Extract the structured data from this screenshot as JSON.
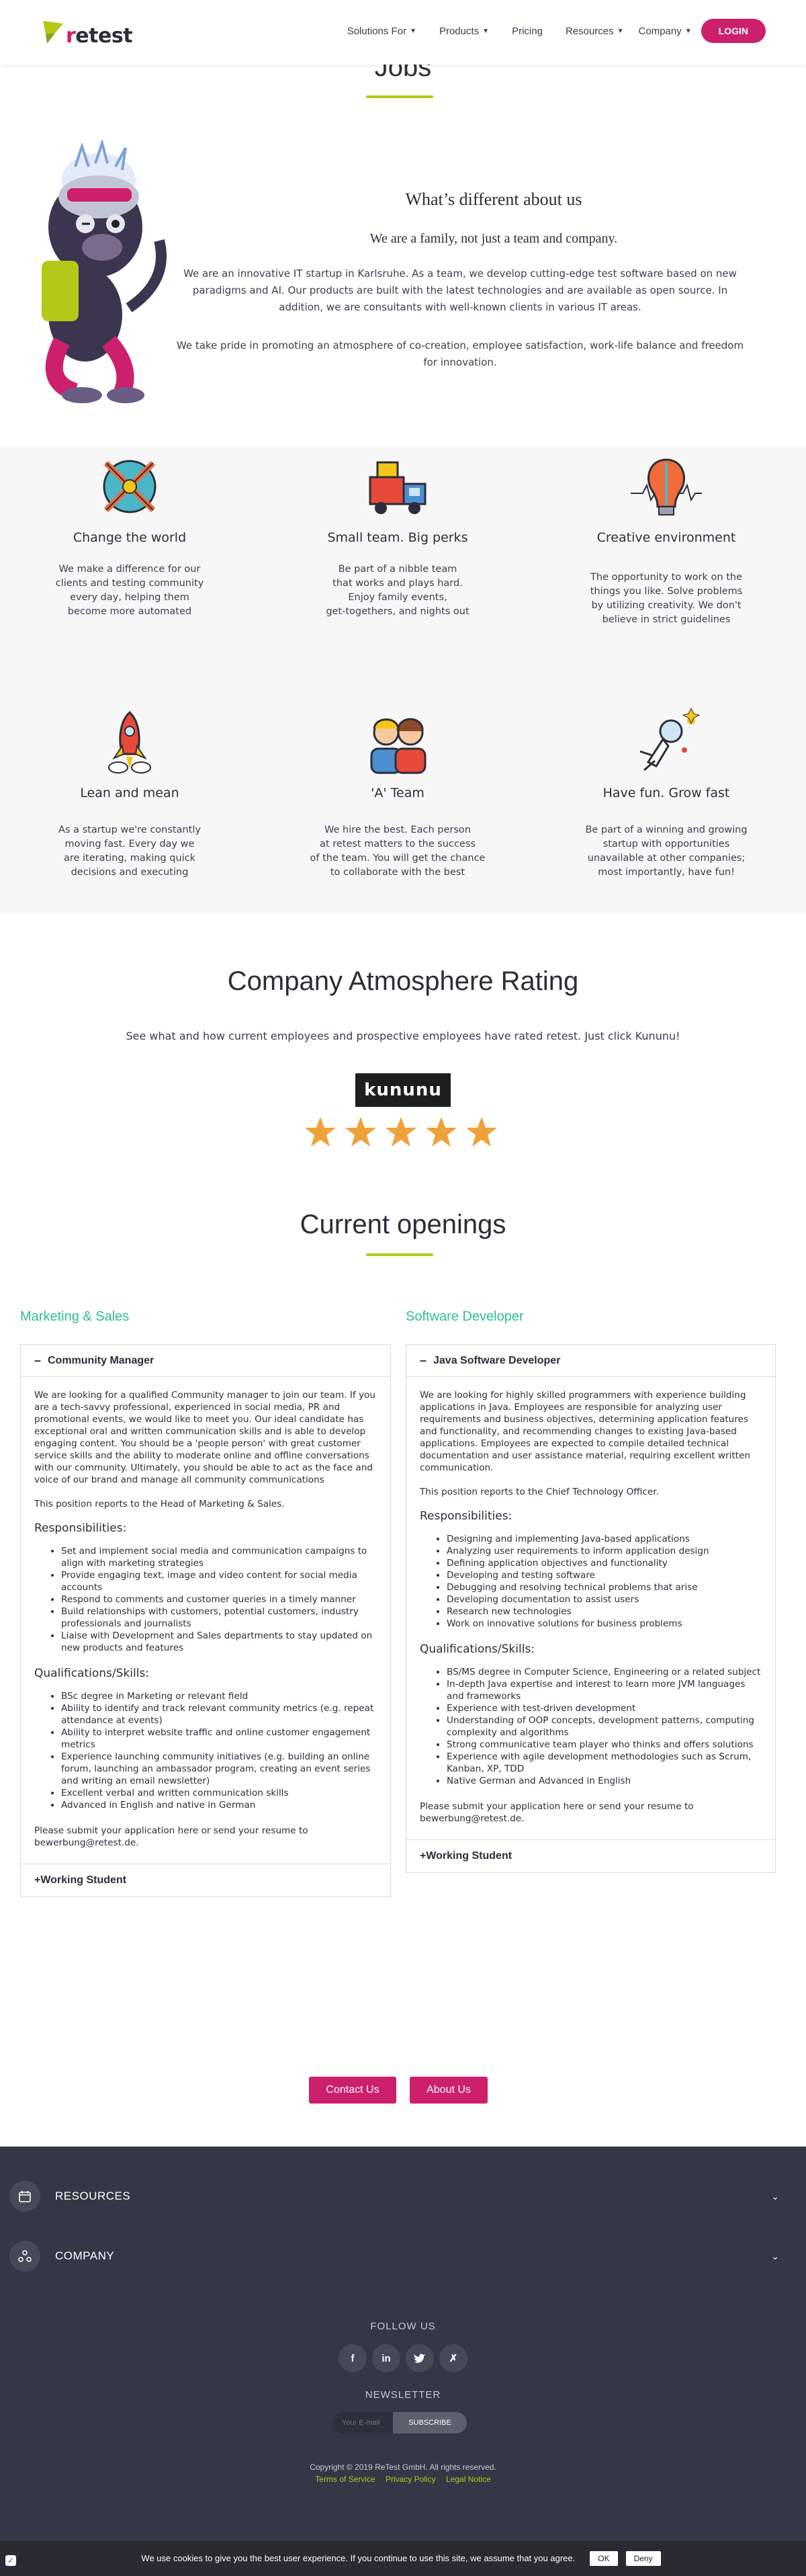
{
  "header": {
    "logo_text": "retest",
    "nav": [
      "Solutions For",
      "Products",
      "Pricing",
      "Resources",
      "Company"
    ],
    "login": "LOGIN"
  },
  "page_title": "Jobs",
  "about": {
    "heading": "What’s different about us",
    "subheading": "We are a family, not just a team and company.",
    "p1": "We are an innovative IT startup in Karlsruhe. As a team, we develop cutting-edge test software based on new paradigms and AI. Our products are built with the latest technologies and are available as open source. In addition, we are consultants with well-known clients in various IT areas.",
    "p2": "We take pride in promoting an atmosphere of co-creation, employee satisfaction, work-life balance and freedom for innovation."
  },
  "perks": [
    {
      "icon": "globe-tools-icon",
      "title": "Change the world",
      "text": "We make a difference for our\nclients and testing community\nevery day, helping them\nbecome more automated"
    },
    {
      "icon": "delivery-truck-icon",
      "title": "Small team. Big perks",
      "text": "Be part of a nibble team\nthat works and plays hard.\nEnjoy family events,\nget-togethers, and nights out"
    },
    {
      "icon": "lightbulb-brain-icon",
      "title": "Creative environment",
      "text": "The opportunity to work on the\nthings you like. Solve problems\nby utilizing creativity. We don't\nbelieve in strict guidelines"
    },
    {
      "icon": "rocket-icon",
      "title": "Lean and mean",
      "text": "As a startup we're constantly\nmoving fast. Every day we\nare iterating, making quick\ndecisions and executing"
    },
    {
      "icon": "team-people-icon",
      "title": "'A' Team",
      "text": "We hire the best. Each person\nat retest matters to the success\nof the team. You will get the chance\nto collaborate with the best"
    },
    {
      "icon": "astronaut-icon",
      "title": "Have fun. Grow fast",
      "text": "Be part of a winning and growing\nstartup with opportunities\nunavailable at other companies;\nmost importantly, have fun!"
    }
  ],
  "rating": {
    "title": "Company Atmosphere Rating",
    "subtitle": "See what and how current employees and prospective employees have rated retest. Just click Kununu!",
    "kununu": "kununu",
    "stars": 5
  },
  "openings_title": "Current openings",
  "marketing": {
    "title": "Marketing & Sales",
    "job": "Community Manager",
    "p1": "We are looking for a qualified Community manager to join our team. If you are a tech-savvy professional, experienced in social media, PR and promotional events, we would like to meet you. Our ideal candidate has exceptional oral and written communication skills and is able to develop engaging content. You should be a 'people person' with great customer service skills and the ability to moderate online and offline conversations with our community. Ultimately, you should be able to act as the face and voice of our brand and manage all community communications",
    "p2": "This position reports to the Head of Marketing & Sales.",
    "resp_title": "Responsibilities:",
    "resp": [
      "Set and implement social media and communication campaigns to align with marketing strategies",
      "Provide engaging text, image and video content for social media accounts",
      "Respond to comments and customer queries in a timely manner",
      "Build relationships with customers, potential customers, industry professionals and journalists",
      "Liaise with Development and Sales departments to stay updated on new products and features"
    ],
    "qual_title": "Qualifications/Skills:",
    "qual": [
      "BSc degree in Marketing or relevant field",
      "Ability to identify and track relevant community metrics (e.g. repeat attendance at events)",
      "Ability to interpret website traffic and online customer engagement metrics",
      "Experience launching community initiatives (e.g. building an online forum, launching an ambassador program, creating an event series and writing an email newsletter)",
      "Excellent verbal and written communication skills",
      "Advanced in English and native in German"
    ],
    "apply": "Please submit your application here or send your resume to bewerbung@retest.de.",
    "other": "Working Student"
  },
  "software": {
    "title": "Software Developer",
    "job": "Java Software Developer",
    "p1": "We are looking for highly skilled programmers with experience building applications in Java. Employees are responsible for analyzing user requirements and business objectives, determining application features and functionality, and recommending changes to existing Java-based applications. Employees are expected to compile detailed technical documentation and user assistance material, requiring excellent written communication.",
    "p2": "This position reports to the Chief Technology Officer.",
    "resp_title": "Responsibilities:",
    "resp": [
      "Designing and implementing Java-based applications",
      "Analyzing user requirements to inform application design",
      "Defining application objectives and functionality",
      "Developing and testing software",
      "Debugging and resolving technical problems that arise",
      "Developing documentation to assist users",
      "Research new technologies",
      "Work on innovative solutions for business problems"
    ],
    "qual_title": "Qualifications/Skills:",
    "qual": [
      "BS/MS degree in Computer Science, Engineering or a related subject",
      "In-depth Java expertise and interest to learn more JVM languages and frameworks",
      "Experience with test-driven development",
      "Understanding of OOP concepts, development patterns, computing complexity and algorithms",
      "Strong communicative team player who thinks and offers solutions",
      "Experience with agile development methodologies such as Scrum, Kanban, XP, TDD",
      "Native German and Advanced in English"
    ],
    "apply": "Please submit your application here or send your resume to bewerbung@retest.de.",
    "other": "Working Student"
  },
  "cta": {
    "contact": "Contact Us",
    "about": "About Us"
  },
  "footer": {
    "resources": "RESOURCES",
    "company": "COMPANY",
    "follow": "FOLLOW US",
    "socials": [
      "f",
      "in",
      "tw",
      "x"
    ],
    "newsletter": "NEWSLETTER",
    "email_placeholder": "Your E-mail",
    "subscribe": "SUBSCRIBE",
    "copyright": "Copyright © 2019 ReTest GmbH. All rights reserved.",
    "terms": "Terms of Service",
    "privacy": "Privacy Policy",
    "legal": "Legal Notice"
  },
  "cookie": {
    "text": "We use cookies to give you the best user experience. If you continue to use this site, we assume that you agree.",
    "ok": "OK",
    "deny": "Deny"
  },
  "colors": {
    "brand": "#cc1f6c",
    "accent_green": "#b5c81a",
    "teal": "#2fbf8f",
    "footer": "#343846"
  }
}
